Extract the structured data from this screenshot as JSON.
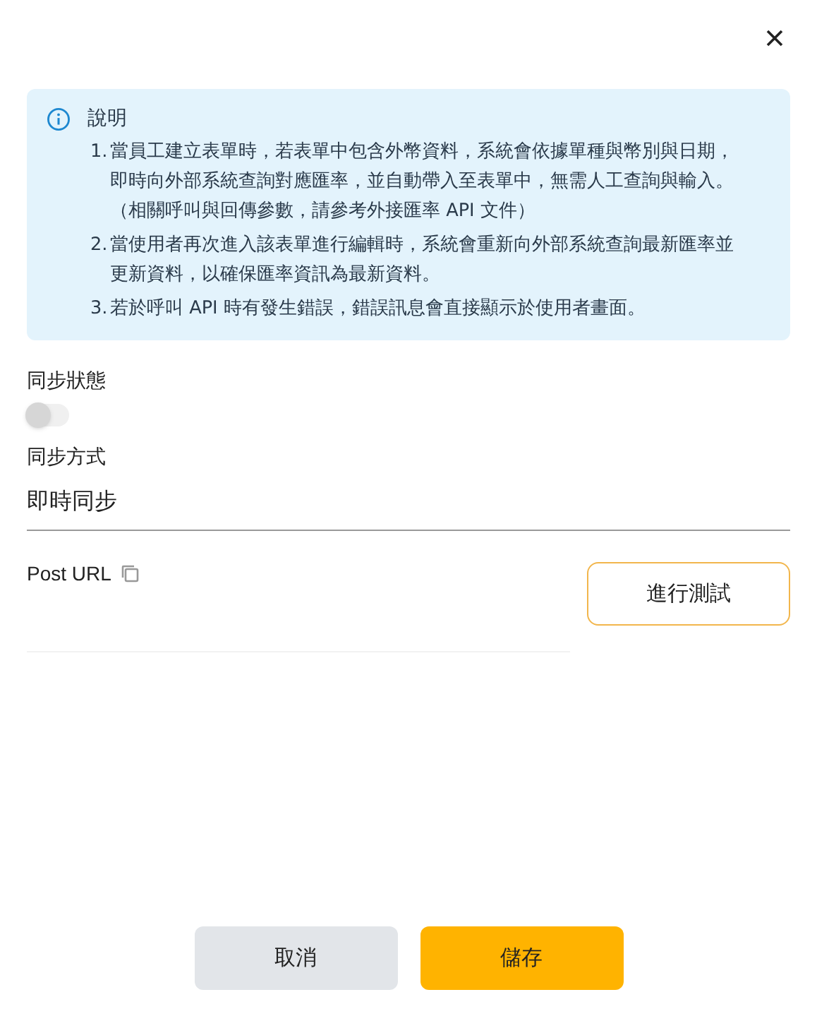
{
  "info": {
    "title": "說明",
    "items": [
      {
        "number": "1.",
        "text": "當員工建立表單時，若表單中包含外幣資料，系統會依據單種與幣別與日期，即時向外部系統查詢對應匯率，並自動帶入至表單中，無需人工查詢與輸入。（相關呼叫與回傳參數，請參考外接匯率 API 文件）"
      },
      {
        "number": "2.",
        "text": "當使用者再次進入該表單進行編輯時，系統會重新向外部系統查詢最新匯率並更新資料，以確保匯率資訊為最新資料。"
      },
      {
        "number": "3.",
        "text": "若於呼叫 API 時有發生錯誤，錯誤訊息會直接顯示於使用者畫面。"
      }
    ]
  },
  "sync_status": {
    "label": "同步狀態",
    "on": false
  },
  "sync_method": {
    "label": "同步方式",
    "value": "即時同步"
  },
  "post_url": {
    "label": "Post URL",
    "test_button": "進行測試"
  },
  "buttons": {
    "cancel": "取消",
    "save": "儲存"
  }
}
